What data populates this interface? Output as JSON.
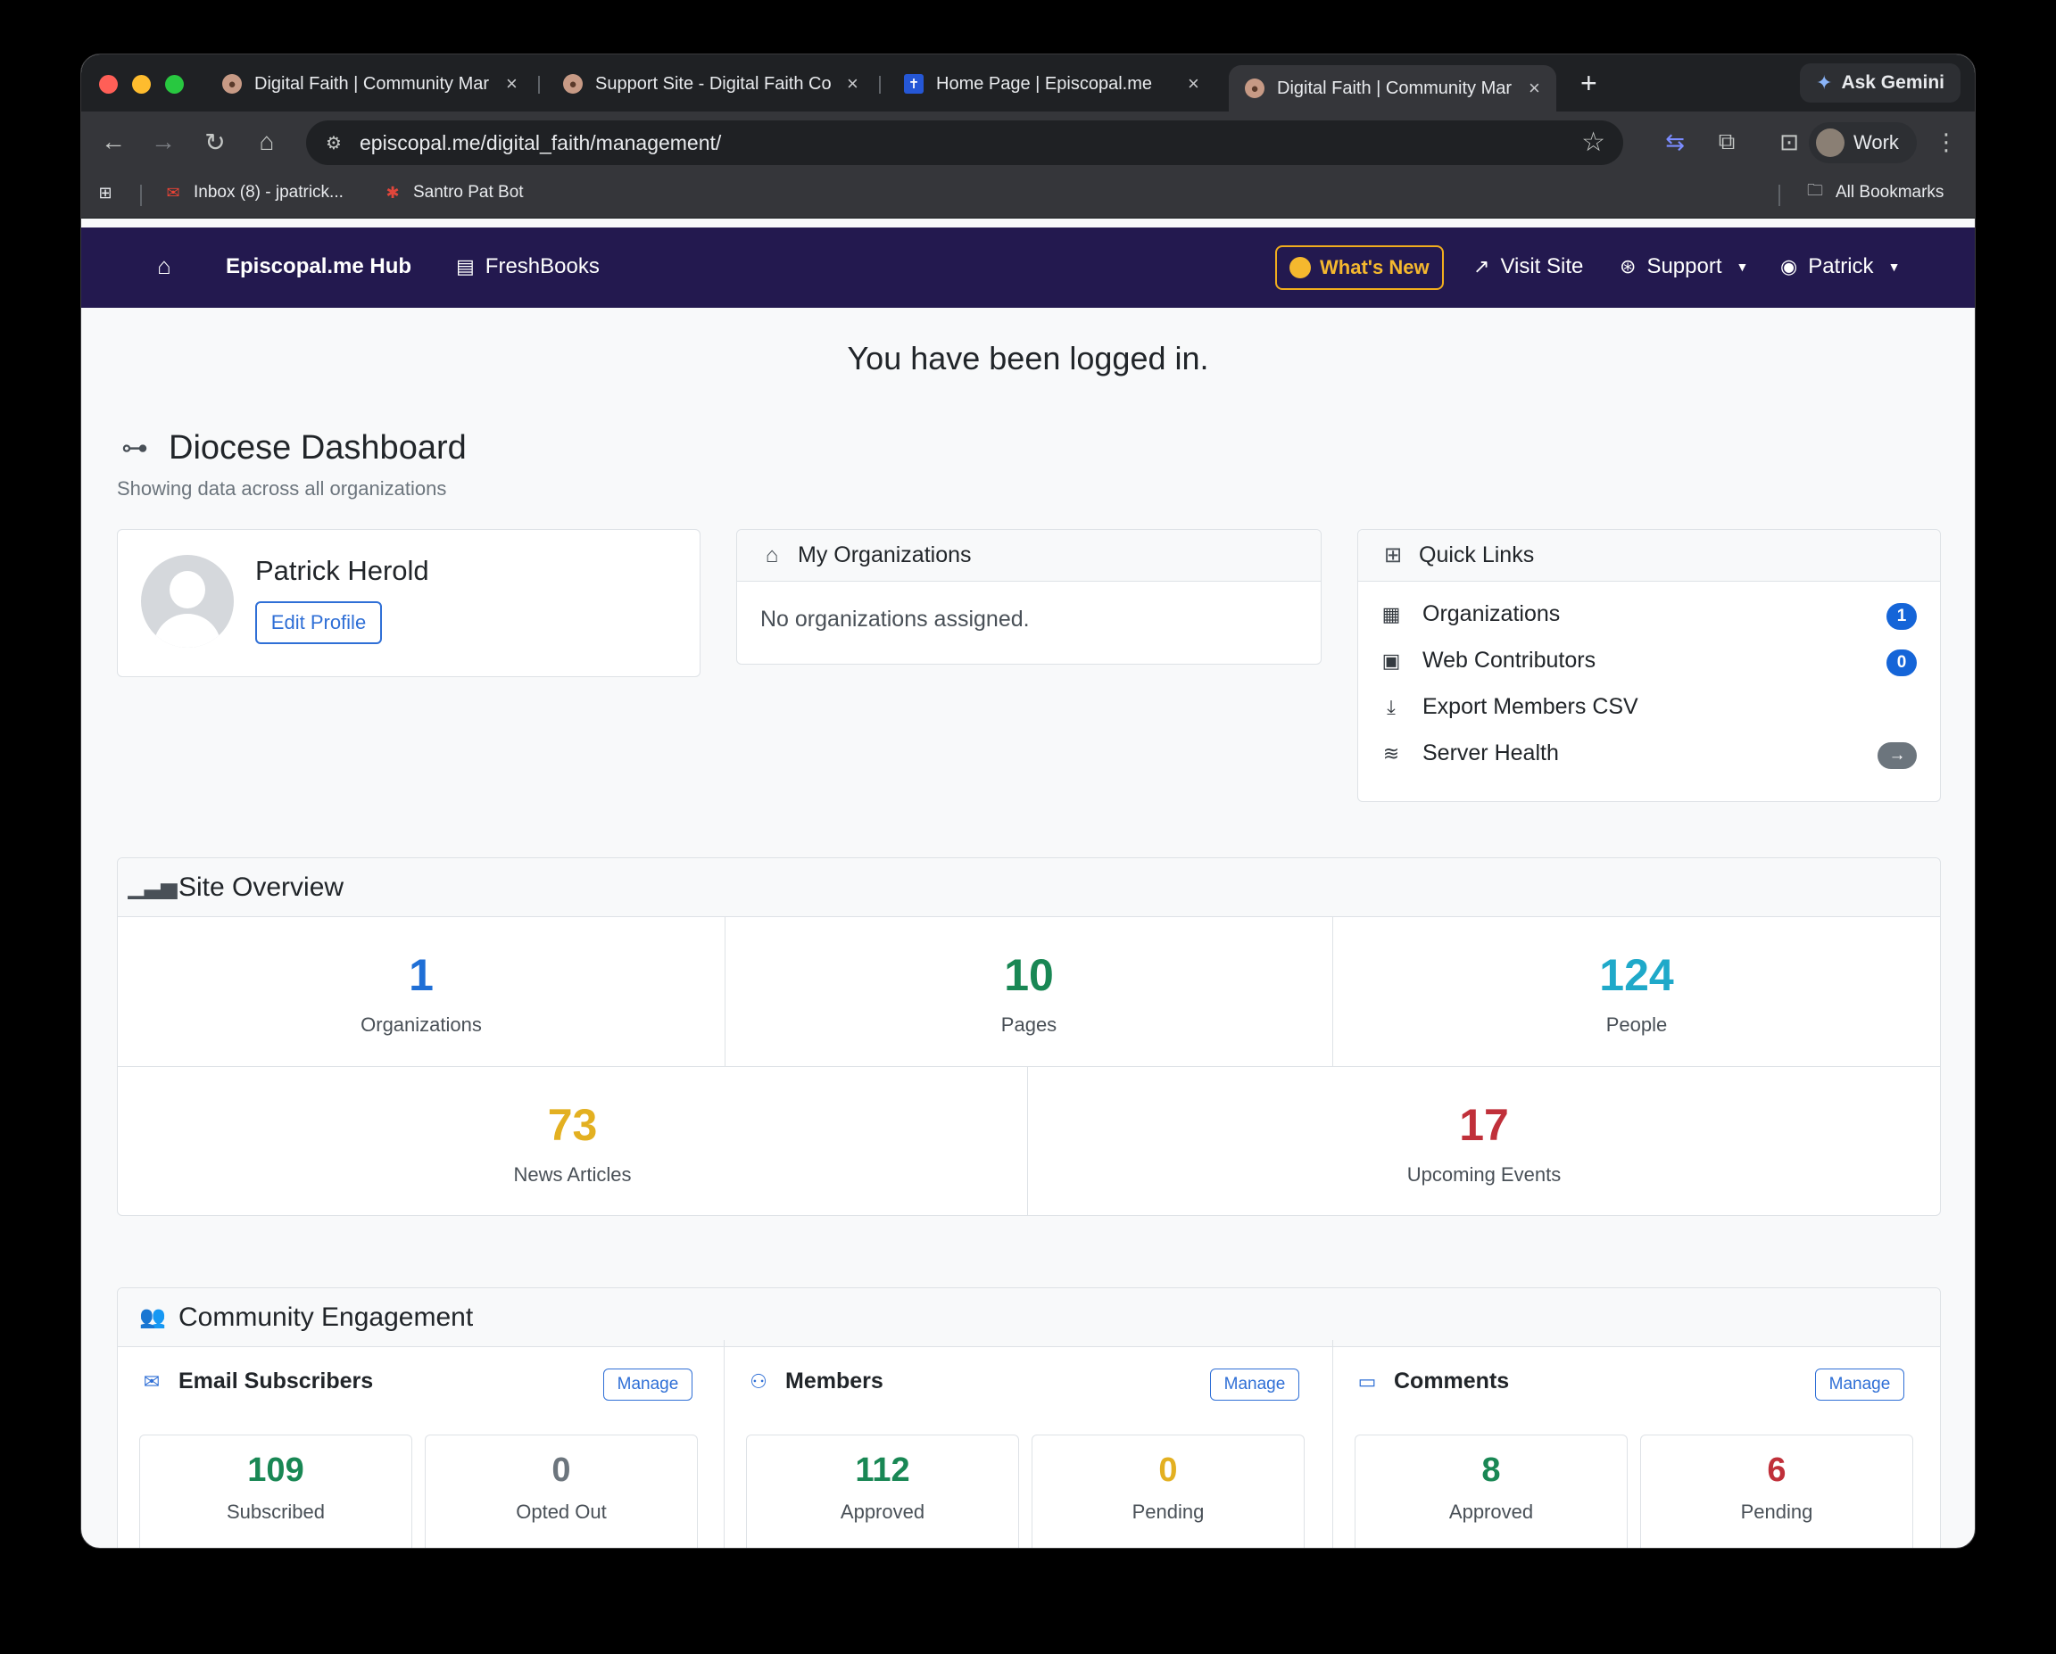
{
  "browser": {
    "tabs": [
      {
        "title": "Digital Faith | Community Mar",
        "active": false
      },
      {
        "title": "Support Site - Digital Faith Co",
        "active": false
      },
      {
        "title": "Home Page | Episcopal.me",
        "active": false
      },
      {
        "title": "Digital Faith | Community Mar",
        "active": true
      }
    ],
    "ask_gemini": "Ask Gemini",
    "url": "episcopal.me/digital_faith/management/",
    "profile_label": "Work",
    "bookmarks": [
      {
        "label": "Inbox (8) - jpatrick..."
      },
      {
        "label": "Santro Pat Bot"
      }
    ],
    "all_bookmarks": "All Bookmarks"
  },
  "navbar": {
    "brand": "Episcopal.me Hub",
    "freshbooks": "FreshBooks",
    "whats_new": "What's New",
    "visit_site": "Visit Site",
    "support": "Support",
    "user": "Patrick",
    "accent_color": "#23194f"
  },
  "flash": "You have been logged in.",
  "dashboard": {
    "title": "Diocese Dashboard",
    "subtitle": "Showing data across all organizations"
  },
  "profile": {
    "name": "Patrick Herold",
    "edit_label": "Edit Profile"
  },
  "my_orgs": {
    "title": "My Organizations",
    "empty": "No organizations assigned."
  },
  "quick_links": {
    "title": "Quick Links",
    "items": [
      {
        "label": "Organizations",
        "badge": "1"
      },
      {
        "label": "Web Contributors",
        "badge": "0"
      },
      {
        "label": "Export Members CSV",
        "badge": ""
      },
      {
        "label": "Server Health",
        "badge": "→"
      }
    ]
  },
  "overview": {
    "title": "Site Overview",
    "stats": [
      {
        "value": "1",
        "label": "Organizations",
        "color": "#1f6fd6"
      },
      {
        "value": "10",
        "label": "Pages",
        "color": "#198754"
      },
      {
        "value": "124",
        "label": "People",
        "color": "#1fa9c9"
      },
      {
        "value": "73",
        "label": "News Articles",
        "color": "#e3b021"
      },
      {
        "value": "17",
        "label": "Upcoming Events",
        "color": "#c0303a"
      }
    ]
  },
  "engagement": {
    "title": "Community Engagement",
    "manage_label": "Manage",
    "groups": [
      {
        "title": "Email Subscribers",
        "stats": [
          {
            "value": "109",
            "label": "Subscribed"
          },
          {
            "value": "0",
            "label": "Opted Out"
          }
        ]
      },
      {
        "title": "Members",
        "stats": [
          {
            "value": "112",
            "label": "Approved"
          },
          {
            "value": "0",
            "label": "Pending"
          }
        ]
      },
      {
        "title": "Comments",
        "stats": [
          {
            "value": "8",
            "label": "Approved"
          },
          {
            "value": "6",
            "label": "Pending"
          }
        ]
      }
    ]
  }
}
